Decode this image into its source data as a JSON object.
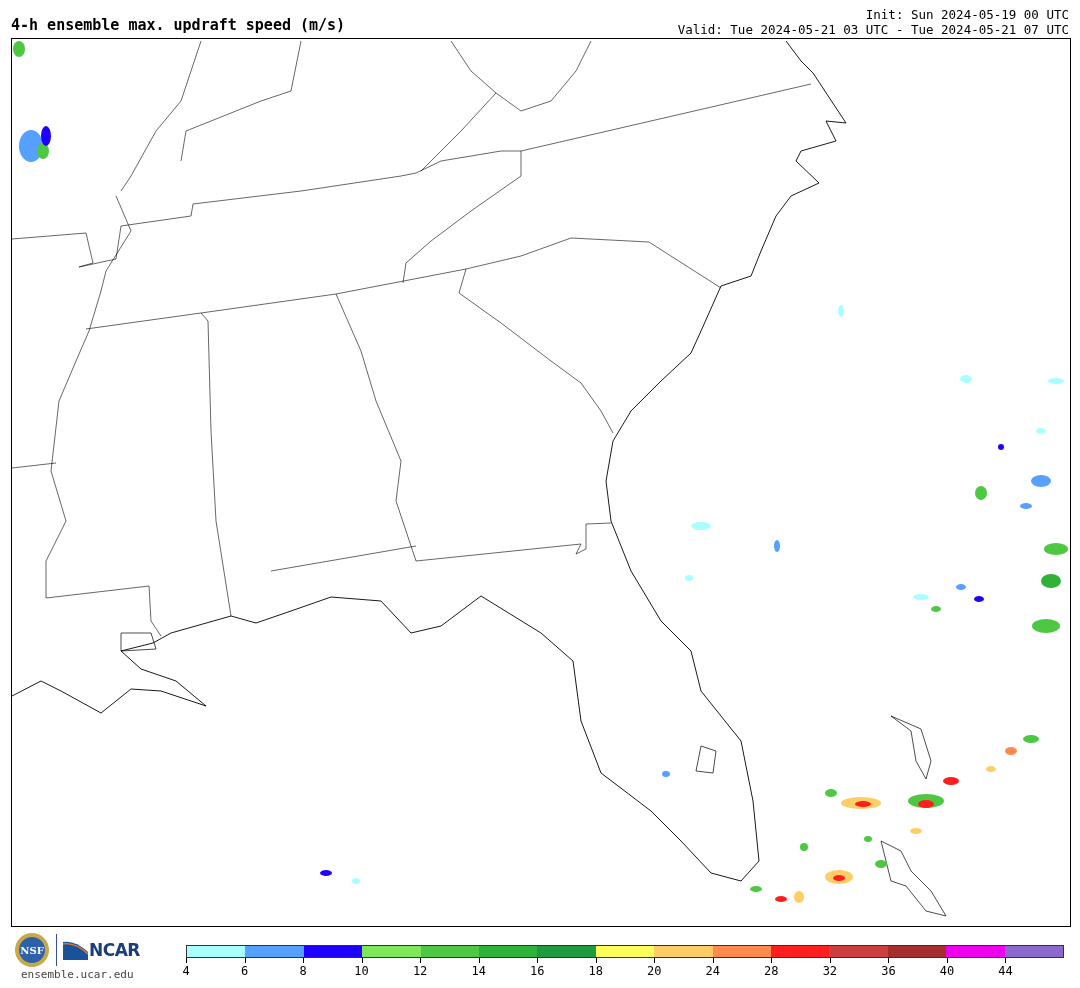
{
  "title": "4-h ensemble max. updraft speed (m/s)",
  "init": "Init: Sun 2024-05-19 00 UTC",
  "valid": "Valid: Tue 2024-05-21 03 UTC - Tue 2024-05-21 07 UTC",
  "logos": {
    "seal_text": "NSF",
    "wordmark": "NCAR",
    "site": "ensemble.ucar.edu"
  },
  "colorbar": {
    "segments": [
      {
        "color": "#a9ffff"
      },
      {
        "color": "#56a0ff"
      },
      {
        "color": "#1e00ff"
      },
      {
        "color": "#80e65a"
      },
      {
        "color": "#4ec843"
      },
      {
        "color": "#2eb23a"
      },
      {
        "color": "#1f9a3f"
      },
      {
        "color": "#ffff5a"
      },
      {
        "color": "#ffcd66"
      },
      {
        "color": "#ff8a4d"
      },
      {
        "color": "#ff1e1e"
      },
      {
        "color": "#cc3f3f"
      },
      {
        "color": "#a52d2d"
      },
      {
        "color": "#ee00ee"
      },
      {
        "color": "#8b68cc"
      }
    ],
    "ticks": [
      "4",
      "6",
      "8",
      "10",
      "12",
      "14",
      "16",
      "18",
      "20",
      "24",
      "28",
      "32",
      "36",
      "40",
      "44"
    ]
  }
}
